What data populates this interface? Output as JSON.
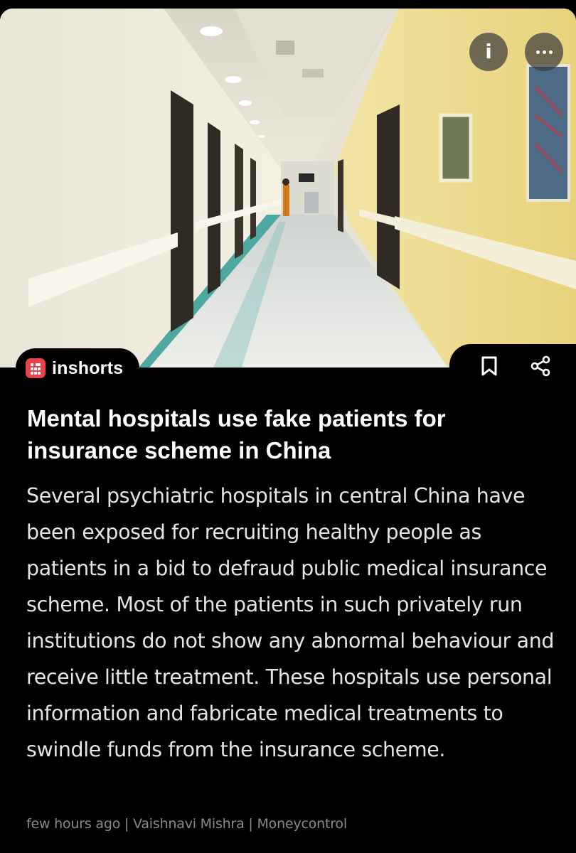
{
  "header": {
    "info_icon": "info-icon",
    "more_icon": "more-dots-icon"
  },
  "brand": {
    "name": "inshorts",
    "logo_color": "#e9434c"
  },
  "actions": {
    "bookmark_icon": "bookmark-icon",
    "share_icon": "share-icon"
  },
  "article": {
    "headline": "Mental hospitals use fake patients for insurance scheme in China",
    "body": "Several psychiatric hospitals in central China have been exposed for recruiting healthy people as patients in a bid to defraud public medical insurance scheme. Most of the patients in such privately run institutions do not show any abnormal behaviour and receive little treatment. These hospitals use personal information and fabricate medical treatments to swindle funds from the insurance scheme.",
    "meta": {
      "time": "few hours ago",
      "author": "Vaishnavi Mishra",
      "source": "Moneycontrol",
      "separator": " | "
    }
  },
  "theme": {
    "background": "#000000",
    "text": "#ffffff",
    "body_text": "#e4e4e4",
    "meta_text": "#8a8a8a"
  }
}
